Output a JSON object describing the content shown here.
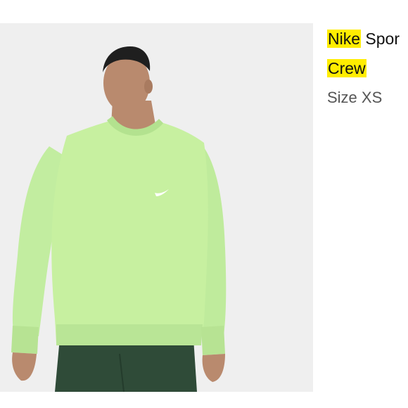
{
  "product": {
    "brand_highlight": "Nike",
    "title_rest": " Spor",
    "style_highlight": "Crew",
    "size_text": "Size XS"
  },
  "image": {
    "icon": "product-photo",
    "subject": "man wearing light green crew sweatshirt"
  },
  "colors": {
    "highlight": "#ffed00",
    "sweatshirt": "#c7f0a0",
    "pants": "#2f4b38",
    "photo_bg": "#efefef"
  }
}
